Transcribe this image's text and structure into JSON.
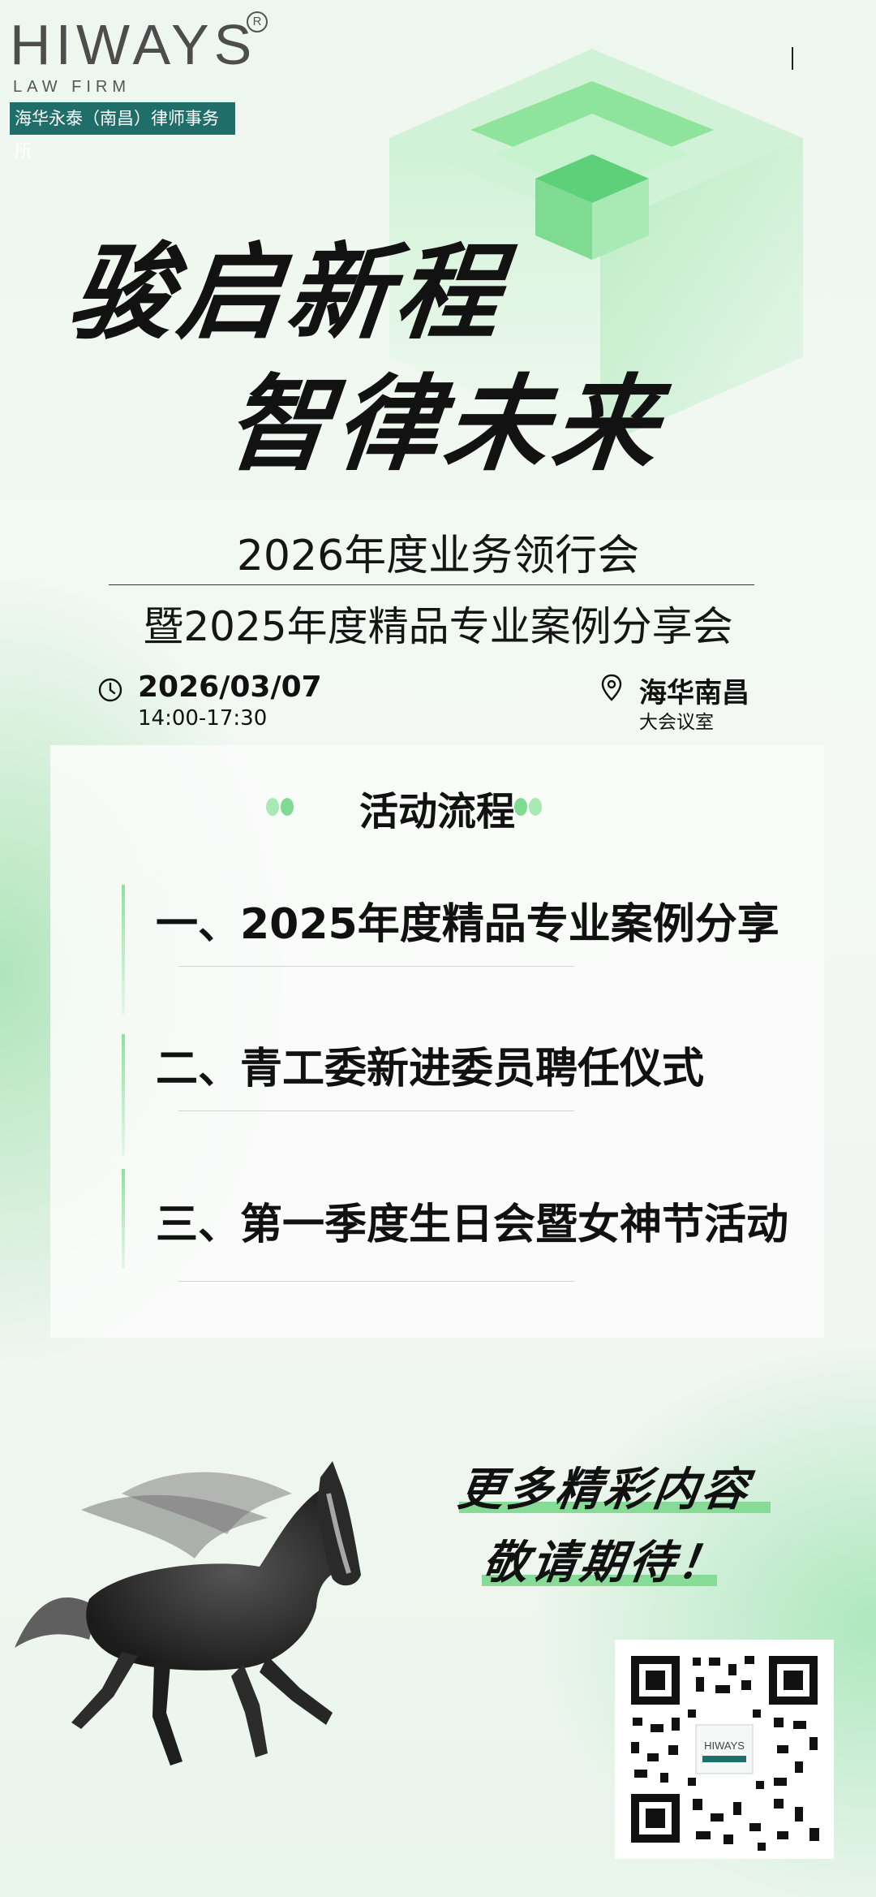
{
  "logo": {
    "brand": "HIWAYS",
    "registered": "R",
    "subtitle": "LAW FIRM",
    "firm_name": "海华永泰（南昌）律师事务所"
  },
  "headline": {
    "line1": "骏启新程",
    "line2": "智律未来"
  },
  "event": {
    "title_line1": "2026年度业务领行会",
    "title_line2": "暨2025年度精品专业案例分享会",
    "date": "2026/03/07",
    "time": "14:00-17:30",
    "location": "海华南昌",
    "room": "大会议室"
  },
  "agenda": {
    "title": "活动流程",
    "steps": [
      "一、2025年度精品专业案例分享",
      "二、青工委新进委员聘任仪式",
      "三、第一季度生日会暨女神节活动"
    ]
  },
  "closing": {
    "line1": "更多精彩内容",
    "line2": "敬请期待！"
  },
  "qr_logo": "HIWAYS",
  "colors": {
    "accent_green": "#86dc97",
    "firm_teal": "#1f6e6a",
    "text": "#111111"
  }
}
